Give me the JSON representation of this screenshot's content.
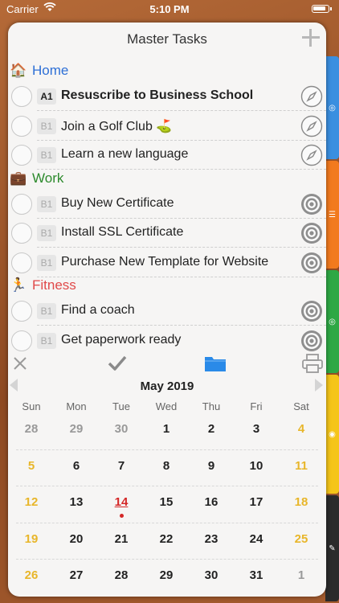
{
  "status_bar": {
    "carrier": "Carrier",
    "time": "5:10 PM"
  },
  "header": {
    "title": "Master Tasks"
  },
  "groups": [
    {
      "name": "Home",
      "icon": "house-icon",
      "emoji": "🏠",
      "color": "#2d6fd6",
      "tasks": [
        {
          "priority": "A1",
          "label": "Resuscribe to Business School",
          "bold": true,
          "action": "compass-icon"
        },
        {
          "priority": "B1",
          "label": "Join a Golf Club ⛳",
          "bold": false,
          "action": "compass-icon"
        },
        {
          "priority": "B1",
          "label": "Learn a new language",
          "bold": false,
          "action": "compass-icon"
        }
      ]
    },
    {
      "name": "Work",
      "icon": "briefcase-icon",
      "emoji": "💼",
      "color": "#2c8a2c",
      "tasks": [
        {
          "priority": "B1",
          "label": "Buy New Certificate",
          "bold": false,
          "action": "target-icon"
        },
        {
          "priority": "B1",
          "label": "Install SSL Certificate",
          "bold": false,
          "action": "target-icon"
        },
        {
          "priority": "B1",
          "label": "Purchase New Template for Website",
          "bold": false,
          "action": "target-icon"
        }
      ]
    },
    {
      "name": "Fitness",
      "icon": "runner-icon",
      "emoji": "🏃",
      "color": "#e04a4a",
      "tasks": [
        {
          "priority": "B1",
          "label": "Find a coach",
          "bold": false,
          "action": "target-icon"
        },
        {
          "priority": "B1",
          "label": "Get paperwork ready",
          "bold": false,
          "action": "target-icon"
        }
      ]
    }
  ],
  "toolbar": {
    "icons": [
      "close-icon",
      "checkmark-icon",
      "folder-icon",
      "print-icon"
    ],
    "accent": "#2a8ae8"
  },
  "calendar": {
    "month": "May 2019",
    "weekdays": [
      "Sun",
      "Mon",
      "Tue",
      "Wed",
      "Thu",
      "Fri",
      "Sat"
    ],
    "weeks": [
      [
        "28",
        "29",
        "30",
        "1",
        "2",
        "3",
        "4"
      ],
      [
        "5",
        "6",
        "7",
        "8",
        "9",
        "10",
        "11"
      ],
      [
        "12",
        "13",
        "14",
        "15",
        "16",
        "17",
        "18"
      ],
      [
        "19",
        "20",
        "21",
        "22",
        "23",
        "24",
        "25"
      ],
      [
        "26",
        "27",
        "28",
        "29",
        "30",
        "31",
        "1"
      ]
    ],
    "today": "14",
    "weekend_color": "#e8b62a",
    "today_color": "#d42727"
  },
  "side_tabs": [
    {
      "color": "#3a8fe0",
      "icon": "compass-icon"
    },
    {
      "color": "#f27a1e",
      "icon": "list-icon"
    },
    {
      "color": "#2ea845",
      "icon": "compass-icon"
    },
    {
      "color": "#f5c518",
      "icon": "target-icon"
    },
    {
      "color": "#2b2b2b",
      "icon": "pen-icon"
    }
  ]
}
